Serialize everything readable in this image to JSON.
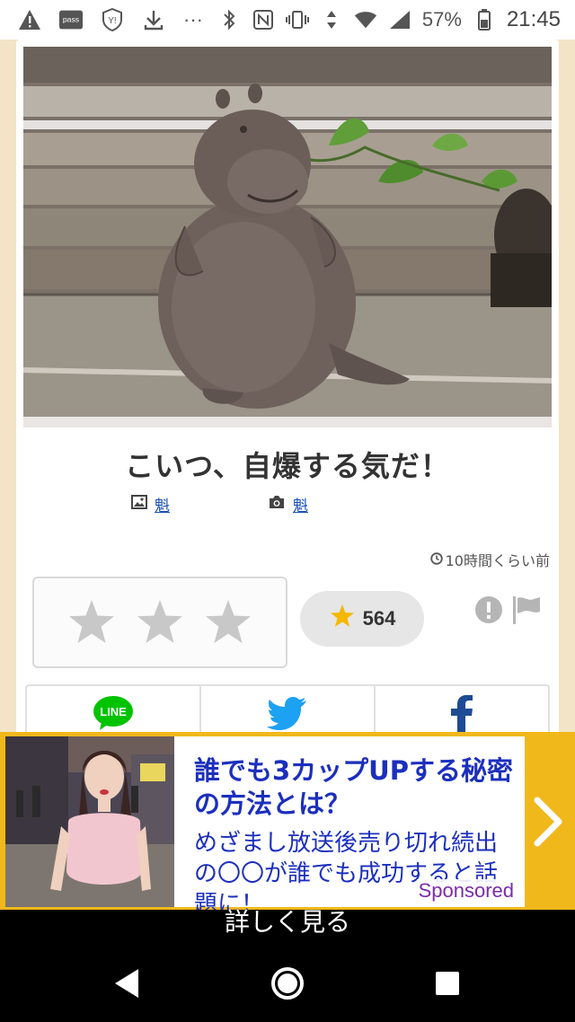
{
  "status_bar": {
    "icons_left": [
      "warning-icon",
      "pass-icon",
      "shield-y-icon",
      "download-icon",
      "more-icon"
    ],
    "pass_label": "pass",
    "more": "···",
    "icons_right": [
      "bluetooth-icon",
      "nfc-icon",
      "vibrate-icon",
      "data-arrows-icon",
      "wifi-icon",
      "signal-icon",
      "battery-icon"
    ],
    "battery": "57%",
    "time": "21:45"
  },
  "post": {
    "image_subject": "ceramic hippo figurine",
    "title": "こいつ、自爆する気だ！",
    "image_credit": "魁",
    "photo_credit": "魁",
    "posted_ago": "10時間くらい前"
  },
  "rating": {
    "stars": 3,
    "count": "564"
  },
  "share": {
    "line_label": "LINE",
    "twitter": "twitter-icon",
    "facebook": "facebook-icon"
  },
  "ad": {
    "headline": "誰でも3カップUPする秘密の方法とは？",
    "body": "めざまし放送後売り切れ続出の〇〇が誰でも成功すると話題に！",
    "sponsored": "Sponsored",
    "cta": "詳しく見る"
  },
  "colors": {
    "background": "#f3e4c7",
    "ad_yellow": "#f0b81b",
    "ad_text": "#1c2fbd",
    "star_gold": "#f5b800",
    "link": "#1a4fb7",
    "line_green": "#00c300",
    "twitter_blue": "#1da1f2",
    "facebook_blue": "#1d4b94"
  }
}
